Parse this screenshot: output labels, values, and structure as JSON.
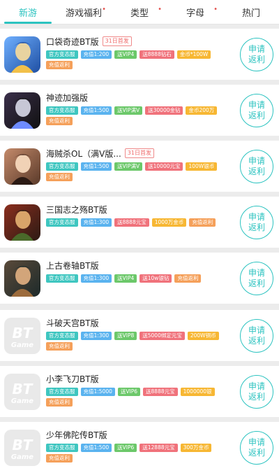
{
  "tabs": [
    {
      "label": "新游",
      "active": true,
      "dot": false
    },
    {
      "label": "游戏福利",
      "active": false,
      "dot": true
    },
    {
      "label": "类型",
      "active": false,
      "dot": true
    },
    {
      "label": "字母",
      "active": false,
      "dot": true
    },
    {
      "label": "热门",
      "active": false,
      "dot": false
    }
  ],
  "tag_colors": {
    "cyan": "#3ec6c0",
    "blue": "#5ab3ef",
    "green": "#6cc86a",
    "pink": "#f0727b",
    "yellow": "#f7b733",
    "orange": "#f5a05a"
  },
  "apply_label": "申请\n返利",
  "games": [
    {
      "title": "口袋奇迹BT版",
      "badge": "31日首发",
      "thumb": "art-blue",
      "tags": [
        [
          "官方变态服",
          "cyan"
        ],
        [
          "充值1:200",
          "blue"
        ],
        [
          "送VIP4",
          "green"
        ],
        [
          "送8888钻石",
          "pink"
        ],
        [
          "金币*100W",
          "yellow"
        ],
        [
          "充值返利",
          "orange"
        ]
      ]
    },
    {
      "title": "神迹加强版",
      "badge": "",
      "thumb": "art-dark",
      "tags": [
        [
          "官方变态服",
          "cyan"
        ],
        [
          "充值1:500",
          "blue"
        ],
        [
          "送VIP满V",
          "green"
        ],
        [
          "送30000金钻",
          "pink"
        ],
        [
          "金币200万",
          "yellow"
        ],
        [
          "充值返利",
          "orange"
        ]
      ]
    },
    {
      "title": "海贼杀OL（满V版...",
      "badge": "31日首发",
      "thumb": "art-woman",
      "tags": [
        [
          "官方变态服",
          "cyan"
        ],
        [
          "充值1:500",
          "blue"
        ],
        [
          "送VIP满V",
          "green"
        ],
        [
          "送10000元宝",
          "pink"
        ],
        [
          "100W银币",
          "yellow"
        ],
        [
          "充值返利",
          "orange"
        ]
      ]
    },
    {
      "title": "三国志之殇BT版",
      "badge": "",
      "thumb": "art-warrior",
      "tags": [
        [
          "官方变态服",
          "cyan"
        ],
        [
          "充值1:300",
          "blue"
        ],
        [
          "送8888元宝",
          "pink"
        ],
        [
          "1000万金币",
          "yellow"
        ],
        [
          "充值返利",
          "orange"
        ]
      ]
    },
    {
      "title": "上古卷轴BT版",
      "badge": "",
      "thumb": "art-hero",
      "tags": [
        [
          "官方变态服",
          "cyan"
        ],
        [
          "充值1:300",
          "blue"
        ],
        [
          "送VIP4",
          "green"
        ],
        [
          "送10w银钻",
          "pink"
        ],
        [
          "充值返利",
          "orange"
        ]
      ]
    },
    {
      "title": "斗破天宫BT版",
      "badge": "",
      "thumb": "bt",
      "tags": [
        [
          "官方变态服",
          "cyan"
        ],
        [
          "充值1:300",
          "blue"
        ],
        [
          "送VIP8",
          "green"
        ],
        [
          "送5000绑定元宝",
          "pink"
        ],
        [
          "200W铜币",
          "yellow"
        ],
        [
          "充值返利",
          "orange"
        ]
      ]
    },
    {
      "title": "小李飞刀BT版",
      "badge": "",
      "thumb": "bt",
      "tags": [
        [
          "官方变态服",
          "cyan"
        ],
        [
          "充值1:5000",
          "blue"
        ],
        [
          "送VIP6",
          "green"
        ],
        [
          "送8888元宝",
          "pink"
        ],
        [
          "1000000银",
          "yellow"
        ],
        [
          "充值返利",
          "orange"
        ]
      ]
    },
    {
      "title": "少年佛陀传BT版",
      "badge": "",
      "thumb": "bt",
      "tags": [
        [
          "官方变态服",
          "cyan"
        ],
        [
          "充值1:500",
          "blue"
        ],
        [
          "送VIP6",
          "green"
        ],
        [
          "送12888元宝",
          "pink"
        ],
        [
          "300万金币",
          "yellow"
        ],
        [
          "充值返利",
          "orange"
        ]
      ]
    }
  ]
}
